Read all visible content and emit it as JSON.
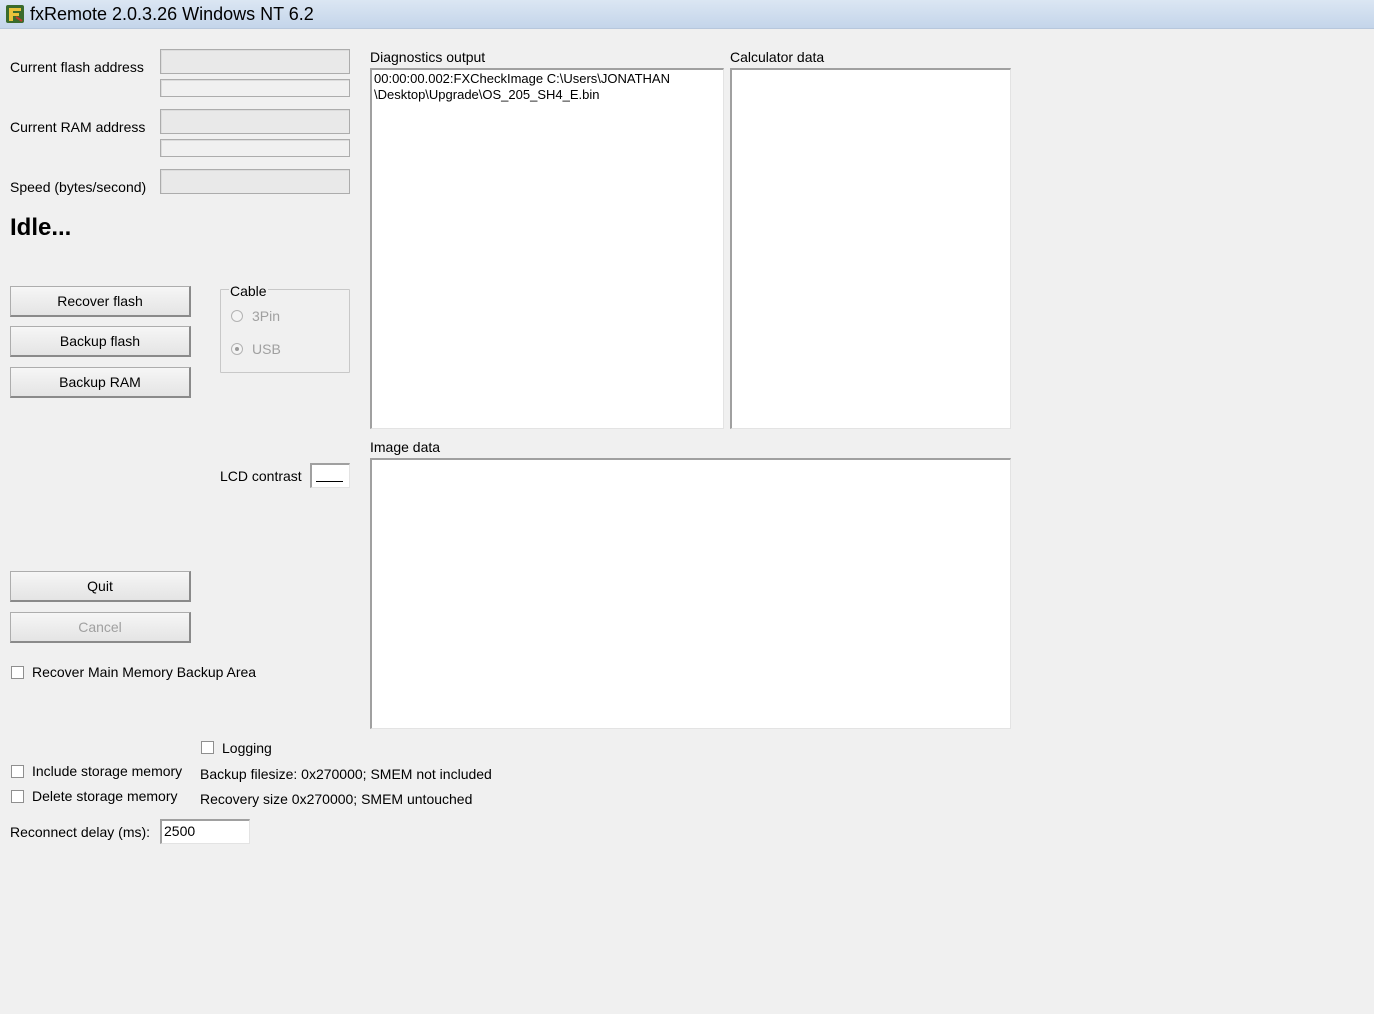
{
  "window": {
    "title": "fxRemote 2.0.3.26 Windows NT 6.2",
    "icon": "fxremote-app-icon"
  },
  "fields": {
    "flash_address_label": "Current flash address",
    "ram_address_label": "Current RAM address",
    "speed_label": "Speed (bytes/second)"
  },
  "status": "Idle...",
  "buttons": {
    "recover_flash": "Recover flash",
    "backup_flash": "Backup flash",
    "backup_ram": "Backup RAM",
    "quit": "Quit",
    "cancel": "Cancel"
  },
  "cable": {
    "legend": "Cable",
    "options": [
      "3Pin",
      "USB"
    ],
    "selected": "USB"
  },
  "lcd": {
    "label": "LCD contrast"
  },
  "panels": {
    "diagnostics_label": "Diagnostics output",
    "diagnostics_text": "00:00:00.002:FXCheckImage C:\\Users\\JONATHAN\n\\Desktop\\Upgrade\\OS_205_SH4_E.bin",
    "calculator_label": "Calculator data",
    "image_label": "Image data"
  },
  "options": {
    "recover_main_memory": "Recover Main Memory Backup Area",
    "logging": "Logging",
    "include_storage": "Include storage memory",
    "delete_storage": "Delete storage memory",
    "backup_filesize": "Backup filesize: 0x270000; SMEM not included",
    "recovery_size": "Recovery size 0x270000; SMEM untouched",
    "reconnect_label": "Reconnect delay (ms):",
    "reconnect_value": "2500"
  }
}
